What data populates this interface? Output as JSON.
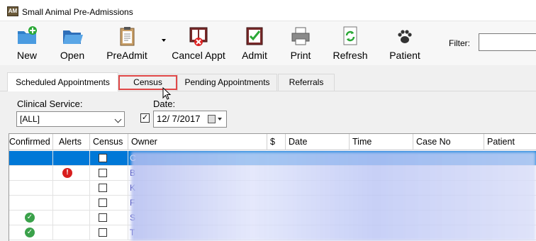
{
  "window": {
    "title": "Small Animal Pre-Admissions",
    "icon_text": "AM"
  },
  "toolbar": {
    "buttons": [
      {
        "label": "New",
        "icon": "new-folder-icon"
      },
      {
        "label": "Open",
        "icon": "open-folder-icon"
      },
      {
        "label": "PreAdmit",
        "icon": "clipboard-icon"
      },
      {
        "label": "Cancel Appt",
        "icon": "cancel-book-icon"
      },
      {
        "label": "Admit",
        "icon": "admit-check-icon"
      },
      {
        "label": "Print",
        "icon": "printer-icon"
      },
      {
        "label": "Refresh",
        "icon": "refresh-icon"
      },
      {
        "label": "Patient",
        "icon": "paw-icon"
      }
    ],
    "filter_label": "Filter:",
    "filter_value": ""
  },
  "tabs": [
    {
      "label": "Scheduled Appointments",
      "active": true
    },
    {
      "label": "Census",
      "active": false,
      "highlighted": true
    },
    {
      "label": "Pending Appointments",
      "active": false
    },
    {
      "label": "Referrals",
      "active": false
    }
  ],
  "form": {
    "clinical_service_label": "Clinical Service:",
    "clinical_service_value": "[ALL]",
    "date_label": "Date:",
    "date_checked": true,
    "date_value": "12/  7/2017"
  },
  "grid": {
    "columns": [
      "Confirmed",
      "Alerts",
      "Census",
      "Owner",
      "$",
      "Date",
      "Time",
      "Case No",
      "Patient"
    ],
    "rows": [
      {
        "confirmed": false,
        "alert": false,
        "census": false,
        "owner_initial": "C",
        "selected": true
      },
      {
        "confirmed": false,
        "alert": true,
        "census": false,
        "owner_initial": "B",
        "selected": false
      },
      {
        "confirmed": false,
        "alert": false,
        "census": false,
        "owner_initial": "K",
        "selected": false
      },
      {
        "confirmed": false,
        "alert": false,
        "census": false,
        "owner_initial": "F",
        "selected": false
      },
      {
        "confirmed": true,
        "alert": false,
        "census": false,
        "owner_initial": "S",
        "selected": false
      },
      {
        "confirmed": true,
        "alert": false,
        "census": false,
        "owner_initial": "T",
        "selected": false
      }
    ]
  },
  "colors": {
    "selection": "#0078d7",
    "highlight_border": "#e04848",
    "alert": "#d81e1e",
    "confirmed": "#3aa14a"
  }
}
